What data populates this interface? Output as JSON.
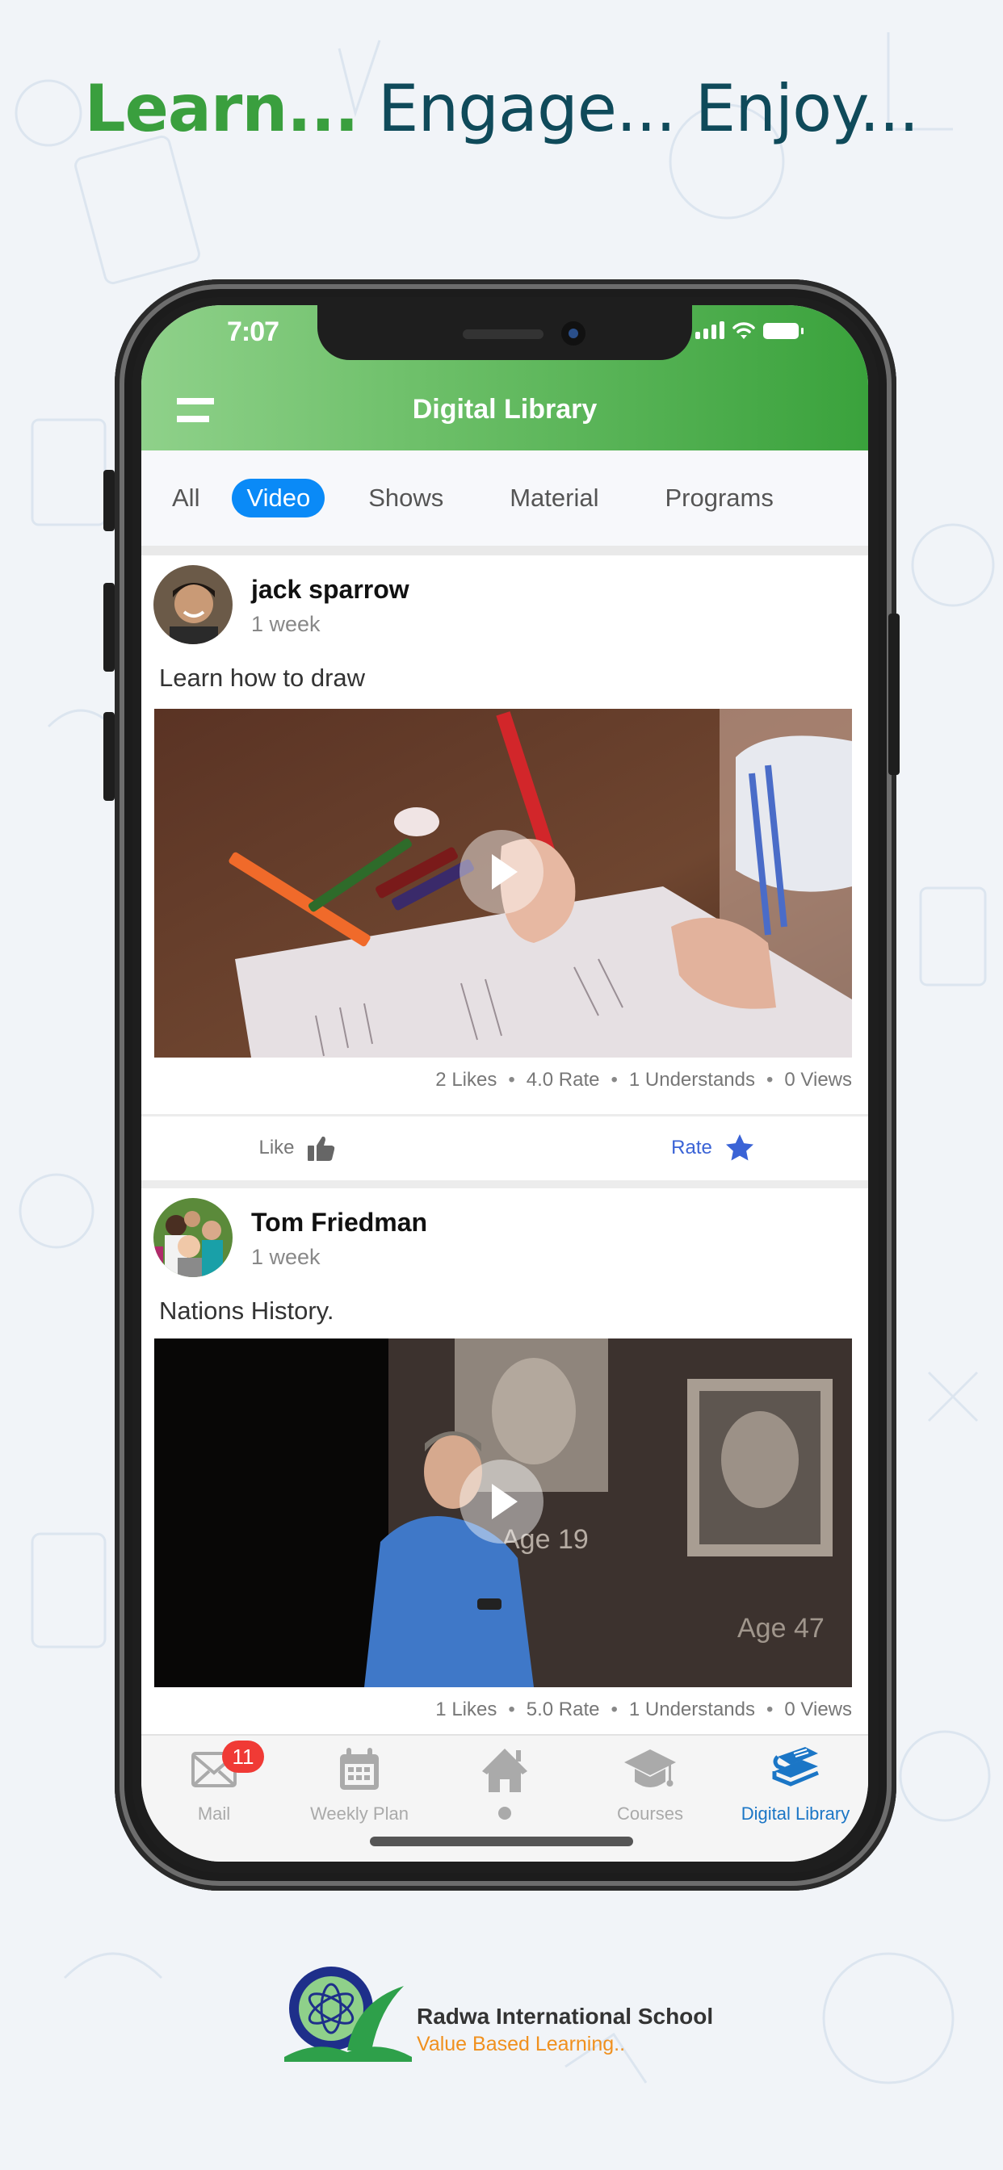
{
  "headline": {
    "learn": "Learn...",
    "rest": " Engage... Enjoy..."
  },
  "status_bar": {
    "time": "7:07"
  },
  "app_bar": {
    "title": "Digital Library"
  },
  "tabs": [
    {
      "label": "All",
      "active": false
    },
    {
      "label": "Video",
      "active": true
    },
    {
      "label": "Shows",
      "active": false
    },
    {
      "label": "Material",
      "active": false
    },
    {
      "label": "Programs",
      "active": false
    }
  ],
  "posts": [
    {
      "author": "jack sparrow",
      "time": "1 week",
      "caption": "Learn how to draw",
      "thumbnail": "child drawing with pencils",
      "stats": {
        "likes": "2 Likes",
        "rate": "4.0 Rate",
        "understands": "1 Understands",
        "views": "0 Views"
      },
      "actions": {
        "like": "Like",
        "rate": "Rate"
      }
    },
    {
      "author": "Tom Friedman",
      "time": "1 week",
      "caption": "Nations History.",
      "thumbnail": "speaker on stage with portraits Age 19 and Age 47",
      "stats": {
        "likes": "1 Likes",
        "rate": "5.0 Rate",
        "understands": "1 Understands",
        "views": "0 Views"
      }
    }
  ],
  "bottom_nav": {
    "items": [
      {
        "label": "Mail",
        "icon": "mail-icon",
        "badge": "11"
      },
      {
        "label": "Weekly Plan",
        "icon": "calendar-icon"
      },
      {
        "label": "",
        "icon": "home-icon"
      },
      {
        "label": "Courses",
        "icon": "graduation-cap-icon"
      },
      {
        "label": "Digital Library",
        "icon": "books-icon",
        "active": true
      }
    ]
  },
  "colors": {
    "brand_green": "#3aa23c",
    "accent_blue": "#0a8af7",
    "active_nav": "#1b76c6",
    "badge_red": "#f03a35",
    "tagline_orange": "#f0901e"
  },
  "footer": {
    "school_name": "Radwa International School",
    "tagline": "Value Based Learning.."
  }
}
